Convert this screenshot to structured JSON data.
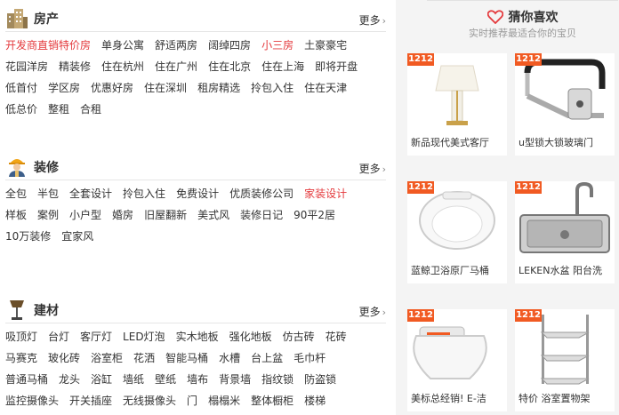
{
  "sections": {
    "house": {
      "title": "房产",
      "more": "更多",
      "tags": [
        {
          "label": "开发商直销特价房",
          "hl": true
        },
        {
          "label": "单身公寓",
          "hl": false
        },
        {
          "label": "舒适两房",
          "hl": false
        },
        {
          "label": "阔绰四房",
          "hl": false
        },
        {
          "label": "小三房",
          "hl": true
        },
        {
          "label": "土豪豪宅",
          "hl": false
        },
        {
          "label": "花园洋房",
          "hl": false
        },
        {
          "label": "精装修",
          "hl": false
        },
        {
          "label": "住在杭州",
          "hl": false
        },
        {
          "label": "住在广州",
          "hl": false
        },
        {
          "label": "住在北京",
          "hl": false
        },
        {
          "label": "住在上海",
          "hl": false
        },
        {
          "label": "即将开盘",
          "hl": false
        },
        {
          "label": "低首付",
          "hl": false
        },
        {
          "label": "学区房",
          "hl": false
        },
        {
          "label": "优惠好房",
          "hl": false
        },
        {
          "label": "住在深圳",
          "hl": false
        },
        {
          "label": "租房精选",
          "hl": false
        },
        {
          "label": "拎包入住",
          "hl": false
        },
        {
          "label": "住在天津",
          "hl": false
        },
        {
          "label": "低总价",
          "hl": false
        },
        {
          "label": "整租",
          "hl": false
        },
        {
          "label": "合租",
          "hl": false
        }
      ]
    },
    "decor": {
      "title": "装修",
      "more": "更多",
      "tags": [
        {
          "label": "全包",
          "hl": false
        },
        {
          "label": "半包",
          "hl": false
        },
        {
          "label": "全套设计",
          "hl": false
        },
        {
          "label": "拎包入住",
          "hl": false
        },
        {
          "label": "免费设计",
          "hl": false
        },
        {
          "label": "优质装修公司",
          "hl": false
        },
        {
          "label": "家装设计",
          "hl": true
        },
        {
          "label": "样板",
          "hl": false
        },
        {
          "label": "案例",
          "hl": false
        },
        {
          "label": "小户型",
          "hl": false
        },
        {
          "label": "婚房",
          "hl": false
        },
        {
          "label": "旧屋翻新",
          "hl": false
        },
        {
          "label": "美式风",
          "hl": false
        },
        {
          "label": "装修日记",
          "hl": false
        },
        {
          "label": "90平2居",
          "hl": false
        },
        {
          "label": "10万装修",
          "hl": false
        },
        {
          "label": "宜家风",
          "hl": false
        }
      ]
    },
    "material": {
      "title": "建材",
      "more": "更多",
      "tags": [
        {
          "label": "吸顶灯",
          "hl": false
        },
        {
          "label": "台灯",
          "hl": false
        },
        {
          "label": "客厅灯",
          "hl": false
        },
        {
          "label": "LED灯泡",
          "hl": false
        },
        {
          "label": "实木地板",
          "hl": false
        },
        {
          "label": "强化地板",
          "hl": false
        },
        {
          "label": "仿古砖",
          "hl": false
        },
        {
          "label": "花砖",
          "hl": false
        },
        {
          "label": "马赛克",
          "hl": false
        },
        {
          "label": "玻化砖",
          "hl": false
        },
        {
          "label": "浴室柜",
          "hl": false
        },
        {
          "label": "花洒",
          "hl": false
        },
        {
          "label": "智能马桶",
          "hl": false
        },
        {
          "label": "水槽",
          "hl": false
        },
        {
          "label": "台上盆",
          "hl": false
        },
        {
          "label": "毛巾杆",
          "hl": false
        },
        {
          "label": "普通马桶",
          "hl": false
        },
        {
          "label": "龙头",
          "hl": false
        },
        {
          "label": "浴缸",
          "hl": false
        },
        {
          "label": "墙纸",
          "hl": false
        },
        {
          "label": "壁纸",
          "hl": false
        },
        {
          "label": "墙布",
          "hl": false
        },
        {
          "label": "背景墙",
          "hl": false
        },
        {
          "label": "指纹锁",
          "hl": false
        },
        {
          "label": "防盗锁",
          "hl": false
        },
        {
          "label": "监控摄像头",
          "hl": false
        },
        {
          "label": "开关插座",
          "hl": false
        },
        {
          "label": "无线摄像头",
          "hl": false
        },
        {
          "label": "门",
          "hl": false
        },
        {
          "label": "榻榻米",
          "hl": false
        },
        {
          "label": "整体橱柜",
          "hl": false
        },
        {
          "label": "楼梯",
          "hl": false
        }
      ]
    }
  },
  "guess": {
    "title": "猜你喜欢",
    "subtitle": "实时推荐最适合你的宝贝",
    "accent": "#e4393c",
    "badge": "1212",
    "badge_color": "#f15a22",
    "products": [
      {
        "name": "新品现代美式客厅",
        "icon": "table-lamp-icon"
      },
      {
        "name": "u型锁大锁玻璃门",
        "icon": "u-lock-icon"
      },
      {
        "name": "蓝鲸卫浴原厂马桶",
        "icon": "toilet-seat-icon"
      },
      {
        "name": "LEKEN水盆 阳台洗",
        "icon": "sink-faucet-icon"
      },
      {
        "name": "美标总经销! E-洁",
        "icon": "smart-toilet-seat-icon"
      },
      {
        "name": "特价 浴室置物架",
        "icon": "corner-shelf-icon"
      }
    ]
  }
}
